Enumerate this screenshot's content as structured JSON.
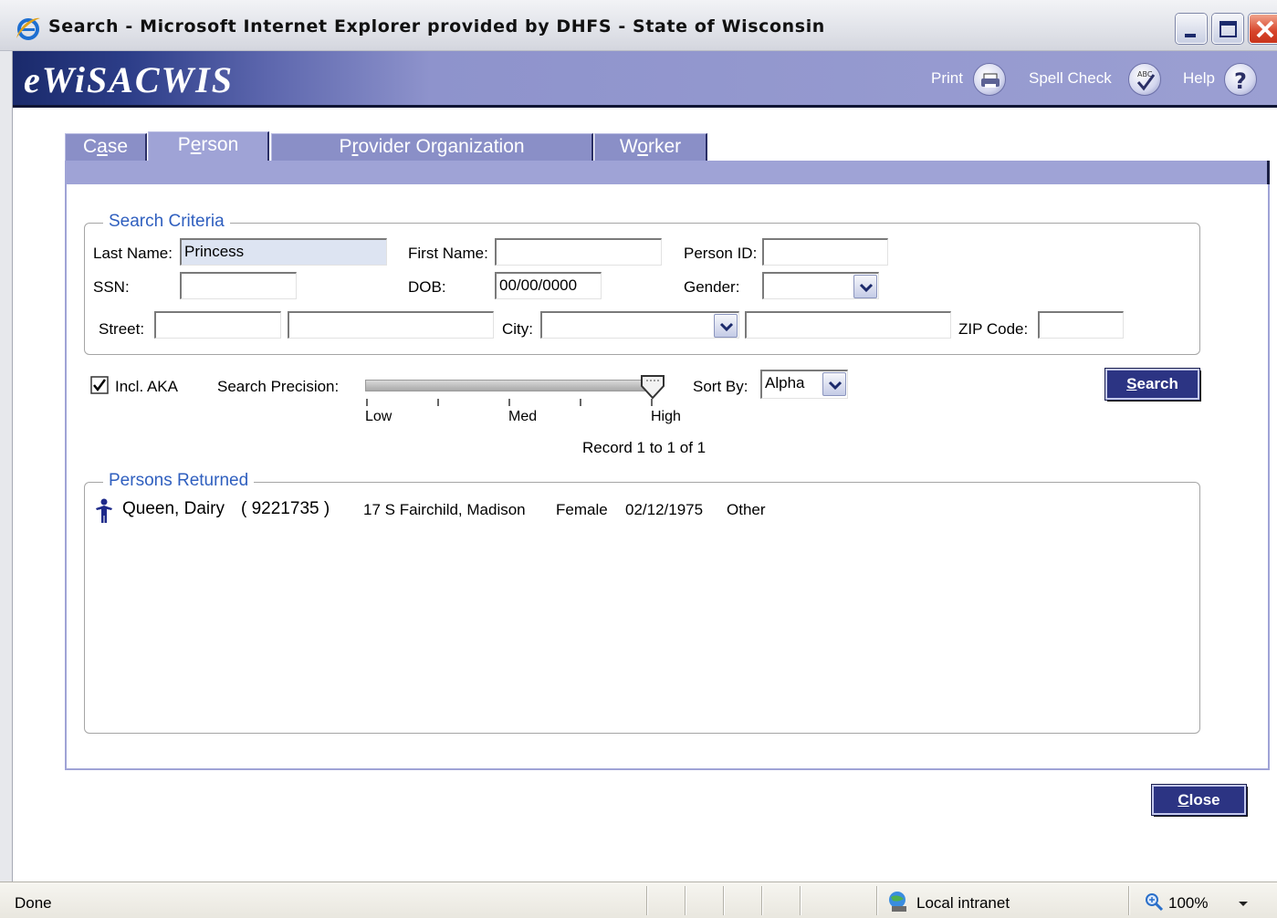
{
  "window": {
    "title": "Search - Microsoft Internet Explorer provided by DHFS - State of Wisconsin"
  },
  "app": {
    "logo": "eWiSACWIS",
    "print_label": "Print",
    "spellcheck_label": "Spell Check",
    "help_label": "Help"
  },
  "tabs": [
    {
      "pre": "C",
      "u": "a",
      "post": "se"
    },
    {
      "pre": "P",
      "u": "e",
      "post": "rson"
    },
    {
      "pre": "P",
      "u": "r",
      "post": "ovider Organization"
    },
    {
      "pre": "W",
      "u": "o",
      "post": "rker"
    }
  ],
  "criteria": {
    "legend": "Search Criteria",
    "last_name_label": "Last Name:",
    "last_name_value": "Princess",
    "first_name_label": "First Name:",
    "first_name_value": "",
    "person_id_label": "Person ID:",
    "person_id_value": "",
    "ssn_label": "SSN:",
    "ssn_value": "",
    "dob_label": "DOB:",
    "dob_value": "00/00/0000",
    "gender_label": "Gender:",
    "gender_value": "",
    "street_label": "Street:",
    "street_number_value": "",
    "street_name_value": "",
    "city_label": "City:",
    "city_value": "",
    "city_extra_value": "",
    "zip_label": "ZIP Code:",
    "zip_value": ""
  },
  "options": {
    "incl_aka_label": "Incl. AKA",
    "incl_aka_checked": true,
    "precision_label": "Search Precision:",
    "precision_level": "High",
    "precision_low": "Low",
    "precision_med": "Med",
    "precision_high": "High",
    "sort_label": "Sort By:",
    "sort_value": "Alpha",
    "search_button_u": "S",
    "search_button_rest": "earch"
  },
  "record_count": "Record 1 to 1 of 1",
  "results": {
    "legend": "Persons Returned",
    "rows": [
      {
        "name": "Queen, Dairy",
        "id": "( 9221735 )",
        "address": "17 S Fairchild, Madison",
        "gender": "Female",
        "dob": "02/12/1975",
        "type": "Other"
      }
    ]
  },
  "close_button_u": "C",
  "close_button_rest": "lose",
  "statusbar": {
    "status": "Done",
    "zone": "Local intranet",
    "zoom": "100%"
  },
  "colors": {
    "header_dark": "#1a2a6b",
    "tab": "#8a8fc7",
    "button": "#2c3483",
    "legend": "#2f5fbf"
  }
}
